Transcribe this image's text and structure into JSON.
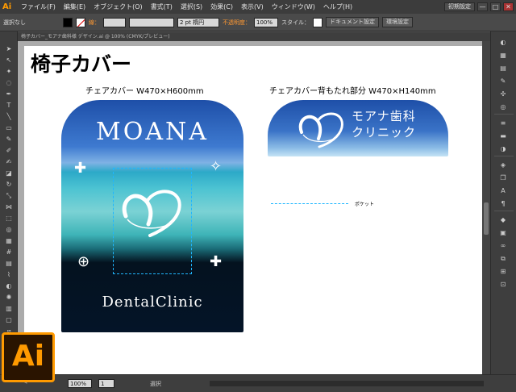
{
  "menubar": {
    "app_icon": "Ai",
    "items": [
      "ファイル(F)",
      "編集(E)",
      "オブジェクト(O)",
      "書式(T)",
      "選択(S)",
      "効果(C)",
      "表示(V)",
      "ウィンドウ(W)",
      "ヘルプ(H)"
    ],
    "workspace": "初期設定",
    "window_buttons": [
      "—",
      "□",
      "✕"
    ]
  },
  "controlbar": {
    "selection_label": "選択なし",
    "stroke_label": "線：",
    "brush_value": "2 pt 楕円",
    "opacity_label": "不透明度：",
    "opacity_value": "100%",
    "style_label": "スタイル：",
    "doc_settings": "ドキュメント設定",
    "preferences": "環境設定"
  },
  "tab": {
    "title": "椅子カバー_モアナ歯科様 デザイン.ai @ 100% (CMYK/プレビュー)"
  },
  "statusbar": {
    "zoom": "100%",
    "page": "1",
    "status": "選択"
  },
  "artwork": {
    "title": "椅子カバー",
    "front_caption": "チェアカバー  W470×H600mm",
    "back_caption": "チェアカバー背もたれ部分  W470×H140mm",
    "moana": "MOANA",
    "dental": "DentalClinic",
    "back_line1": "モアナ歯科",
    "back_line2": "クリニック",
    "pocket_label": "ポケット"
  },
  "colors": {
    "accent": "#ff9a00",
    "guide": "#1fb6ff",
    "sky": "#1e4fa8"
  }
}
